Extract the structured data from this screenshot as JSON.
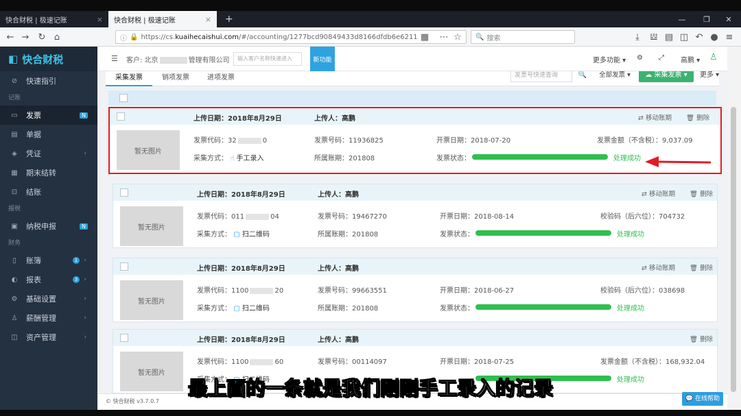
{
  "browser": {
    "tabs": [
      {
        "label": "快合财税 | 极速记账",
        "close": "×"
      },
      {
        "label": "快合财税 | 极速记账",
        "close": "×"
      }
    ],
    "new_tab": "+",
    "url_prefix": "https://cs.",
    "url_domain": "kuaihecaishui.com",
    "url_rest": "/#/accounting/1277bcd90849433d8166dfdb6e6211",
    "search_placeholder": "搜索",
    "controls": {
      "minimize": "—",
      "maximize": "❐",
      "close": "✕"
    }
  },
  "sidebar": {
    "logo": "快合财税",
    "items": [
      {
        "label": "快速指引",
        "icon": "compass-icon"
      },
      {
        "group": "记账"
      },
      {
        "label": "发票",
        "icon": "invoice-icon",
        "badge": "N",
        "active": true
      },
      {
        "label": "单据",
        "icon": "document-icon"
      },
      {
        "label": "凭证",
        "icon": "voucher-icon",
        "chevron": "›"
      },
      {
        "label": "期末结转",
        "icon": "period-end-icon"
      },
      {
        "label": "结账",
        "icon": "lock-icon"
      },
      {
        "group": "报税"
      },
      {
        "label": "纳税申报",
        "icon": "tax-declare-icon",
        "badge": "N"
      },
      {
        "group": "财务"
      },
      {
        "label": "账簿",
        "icon": "ledger-icon",
        "dot": "1",
        "chevron": "›"
      },
      {
        "label": "报表",
        "icon": "report-icon",
        "dot": "3",
        "chevron": "›"
      },
      {
        "label": "基础设置",
        "icon": "gear-icon",
        "chevron": "›"
      },
      {
        "label": "薪酬管理",
        "icon": "salary-icon",
        "chevron": "›"
      },
      {
        "label": "资产管理",
        "icon": "asset-icon",
        "chevron": "›"
      }
    ]
  },
  "header": {
    "customer_label": "客户: 北京",
    "customer_name": "管理有限公司",
    "customer_input_placeholder": "输入客户名称快速进入",
    "new_feature": "新功能",
    "more_functions": "更多功能 ▾",
    "user": "高鹏 ▾"
  },
  "tabs": [
    {
      "label": "采集发票",
      "active": true
    },
    {
      "label": "销项发票"
    },
    {
      "label": "进项发票"
    }
  ],
  "toolbar": {
    "quick_search_placeholder": "发票号快速查询",
    "all_invoices": "全部发票 ▾",
    "collect": "采集发票 ▾",
    "more": "更多 ▾"
  },
  "invoices": [
    {
      "upload_date": "上传日期：2018年8月29日",
      "uploader": "上传人：高鹏",
      "move": "⇄ 移动账期",
      "del": "🗑 删除",
      "thumb": "暂无图片",
      "code": "发票代码：32",
      "code_tail": "0",
      "number": "发票号码：11936825",
      "issue_date": "开票日期：2018-07-20",
      "extra": "发票金额（不含税）：9,037.09",
      "method": "采集方式：",
      "method_val": "手工录入",
      "period": "所属账期：201808",
      "status": "发票状态：",
      "ok": "处理成功"
    },
    {
      "upload_date": "上传日期：2018年8月29日",
      "uploader": "上传人：高鹏",
      "move": "⇄ 移动账期",
      "del": "🗑 删除",
      "thumb": "暂无图片",
      "code": "发票代码：011",
      "code_tail": "04",
      "number": "发票号码：19467270",
      "issue_date": "开票日期：2018-08-14",
      "extra": "校验码（后六位）：704732",
      "method": "采集方式：",
      "method_val": "扫二维码",
      "period": "所属账期：201808",
      "status": "发票状态：",
      "ok": "处理成功"
    },
    {
      "upload_date": "上传日期：2018年8月29日",
      "uploader": "上传人：高鹏",
      "move": "⇄ 移动账期",
      "del": "🗑 删除",
      "thumb": "暂无图片",
      "code": "发票代码：1100",
      "code_tail": "20",
      "number": "发票号码：99663551",
      "issue_date": "开票日期：2018-06-27",
      "extra": "校验码（后六位）：038698",
      "method": "采集方式：",
      "method_val": "扫二维码",
      "period": "所属账期：201808",
      "status": "发票状态：",
      "ok": "处理成功"
    },
    {
      "upload_date": "上传日期：2018年8月29日",
      "uploader": "上传人：高鹏",
      "move": "",
      "del": "🗑 删除",
      "thumb": "暂无图片",
      "code": "发票代码：1100",
      "code_tail": "60",
      "number": "发票号码：00114097",
      "issue_date": "开票日期：2018-07-25",
      "extra": "发票金额（不含税）：168,932.04",
      "method": "采集方式：",
      "method_val": "扫二维码",
      "period": "",
      "status": "",
      "ok": "处理成功"
    }
  ],
  "subtitle": "最上面的一条就是我们刚刚手工录入的记录",
  "footer": "© 快合财税 v3.7.0.7",
  "help": "在线帮助",
  "colors": {
    "accent": "#2e9de0",
    "success": "#2fbf4f",
    "highlight": "#e31b23",
    "sidebar": "#243140"
  }
}
